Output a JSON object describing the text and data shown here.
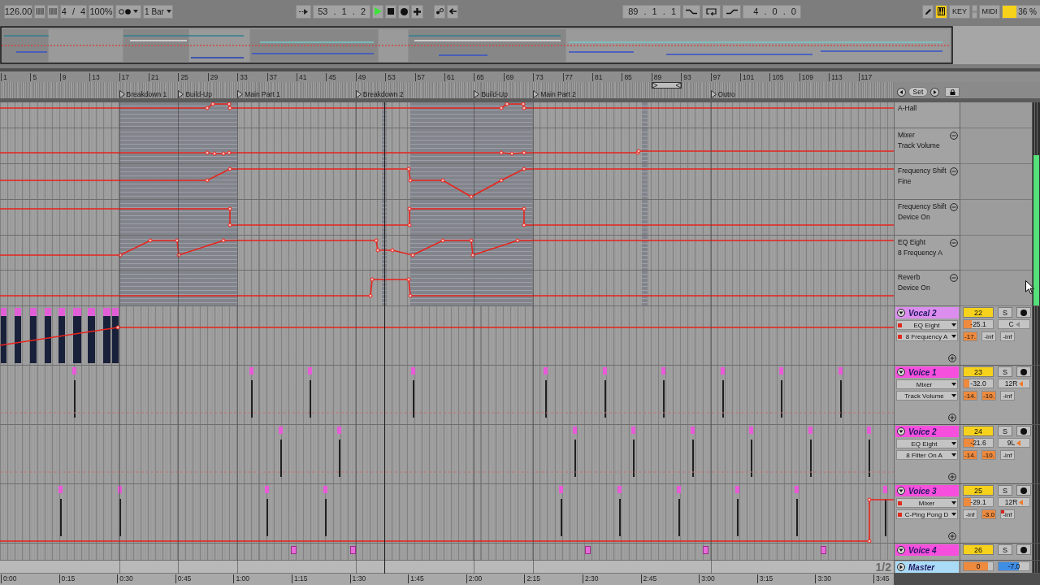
{
  "toolbar": {
    "tempo": "126.00",
    "signature": "4 / 4",
    "zoom": "100%",
    "quantization": "1 Bar",
    "position": "53 . 1 . 2",
    "playing": true,
    "loop_start": "89 . 1 . 1",
    "loop_length": "4 . 0 . 0",
    "keyboard_on": true,
    "key_label": "KEY",
    "midi_label": "MIDI",
    "cpu": {
      "reading": "36 %",
      "level": 0.36
    }
  },
  "ruler": {
    "bars": [
      "1",
      "5",
      "9",
      "13",
      "17",
      "21",
      "25",
      "29",
      "33",
      "37",
      "41",
      "45",
      "49",
      "53",
      "57",
      "61",
      "65",
      "69",
      "73",
      "77",
      "81",
      "85",
      "89",
      "93",
      "97",
      "101",
      "105",
      "109",
      "113",
      "117"
    ]
  },
  "locators": [
    {
      "name": "Breakdown 1"
    },
    {
      "name": "Build-Up"
    },
    {
      "name": "Main Part 1"
    },
    {
      "name": "Breakdown 2"
    },
    {
      "name": "Build-Up"
    },
    {
      "name": "Main Part 2"
    },
    {
      "name": "Outro"
    }
  ],
  "locator_set": "Set",
  "automation_lanes": [
    {
      "kind": "cut",
      "parameter": "A-Hall"
    },
    {
      "kind": "full",
      "device": "Mixer",
      "parameter": "Track Volume"
    },
    {
      "kind": "full",
      "device": "Frequency Shift",
      "parameter": "Fine"
    },
    {
      "kind": "full",
      "device": "Frequency Shift",
      "parameter": "Device On"
    },
    {
      "kind": "full",
      "device": "EQ Eight",
      "parameter": "8 Frequency A"
    },
    {
      "kind": "full",
      "device": "Reverb",
      "parameter": "Device On"
    }
  ],
  "automation_meter": {
    "level": 0.74
  },
  "tracks": [
    {
      "name": "Vocal 2",
      "color": "#dc8eef",
      "expanded": true,
      "number": "22",
      "active": true,
      "solo_label": "S",
      "solo": false,
      "armed": false,
      "device": {
        "label": "EQ Eight",
        "automated": true
      },
      "parameter": {
        "label": "8 Frequency A",
        "automated": true
      },
      "volume": {
        "value": "-25.1",
        "level": 0.29
      },
      "pan": {
        "value": "C",
        "panned": false
      },
      "meters": [
        {
          "value": "-17.",
          "peak": true,
          "clipped": false
        },
        {
          "value": "-inf",
          "peak": false,
          "clipped": false
        },
        {
          "value": "-inf",
          "peak": false,
          "clipped": false
        }
      ]
    },
    {
      "name": "Voice 1",
      "color": "#f64fdd",
      "expanded": true,
      "number": "23",
      "active": true,
      "solo_label": "S",
      "solo": false,
      "armed": false,
      "device": {
        "label": "Mixer",
        "automated": false
      },
      "parameter": {
        "label": "Track Volume",
        "automated": false
      },
      "volume": {
        "value": "-32.0",
        "level": 0.2
      },
      "pan": {
        "value": "12R",
        "panned": true
      },
      "meters": [
        {
          "value": "-14.",
          "peak": true,
          "clipped": false
        },
        {
          "value": "-10.",
          "peak": true,
          "clipped": false
        },
        {
          "value": "-inf",
          "peak": false,
          "clipped": false
        }
      ]
    },
    {
      "name": "Voice 2",
      "color": "#f64fdd",
      "expanded": true,
      "number": "24",
      "active": true,
      "solo_label": "S",
      "solo": false,
      "armed": false,
      "device": {
        "label": "EQ Eight",
        "automated": false
      },
      "parameter": {
        "label": "8 Filter On A",
        "automated": false
      },
      "volume": {
        "value": "-21.6",
        "level": 0.35
      },
      "pan": {
        "value": "9L",
        "panned": true
      },
      "meters": [
        {
          "value": "-14.",
          "peak": true,
          "clipped": false
        },
        {
          "value": "-10.",
          "peak": true,
          "clipped": false
        },
        {
          "value": "-inf",
          "peak": false,
          "clipped": false
        }
      ]
    },
    {
      "name": "Voice 3",
      "color": "#f64fdd",
      "expanded": true,
      "number": "25",
      "active": true,
      "solo_label": "S",
      "solo": false,
      "armed": false,
      "device": {
        "label": "Mixer",
        "automated": true
      },
      "parameter": {
        "label": "C-Ping Pong D",
        "automated": true
      },
      "volume": {
        "value": "-29.1",
        "level": 0.25
      },
      "pan": {
        "value": "12R",
        "panned": true
      },
      "meters": [
        {
          "value": "-inf",
          "peak": false,
          "clipped": false
        },
        {
          "value": "-3.0",
          "peak": true,
          "clipped": false
        },
        {
          "value": "-inf",
          "peak": false,
          "clipped": true
        }
      ]
    },
    {
      "name": "Voice 4",
      "color": "#f64fdd",
      "expanded": true,
      "number": "26",
      "active": true,
      "solo_label": "S",
      "solo": false,
      "armed": false
    }
  ],
  "master": {
    "name": "Master",
    "color": "#a9dbf7",
    "expanded": false,
    "cue": {
      "value": "0",
      "level": 0.83
    },
    "volume": {
      "value": "-7.0",
      "level": 0.67
    }
  },
  "page": "1/2",
  "time_ruler": [
    "0:00",
    "0:15",
    "0:30",
    "0:45",
    "1:00",
    "1:15",
    "1:30",
    "1:45",
    "2:00",
    "2:15",
    "2:30",
    "2:45",
    "3:00",
    "3:15",
    "3:30",
    "3:45"
  ]
}
